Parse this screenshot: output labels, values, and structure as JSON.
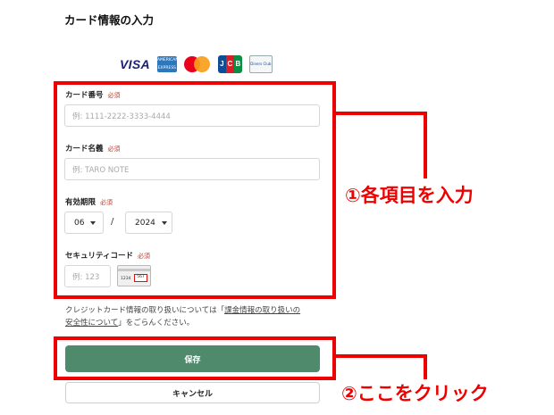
{
  "page": {
    "title": "カード情報の入力"
  },
  "brands": {
    "visa": "VISA",
    "amex": "AMERICAN EXPRESS",
    "jcb": [
      "J",
      "C",
      "B"
    ],
    "diners": "Diners Club"
  },
  "form": {
    "card_number": {
      "label": "カード番号",
      "required": "必須",
      "placeholder": "例: 1111-2222-3333-4444"
    },
    "card_name": {
      "label": "カード名義",
      "required": "必須",
      "placeholder": "例: TARO NOTE"
    },
    "expiry": {
      "label": "有効期限",
      "required": "必須",
      "month": "06",
      "separator": "/",
      "year": "2024"
    },
    "security": {
      "label": "セキュリティコード",
      "required": "必須",
      "placeholder": "例: 123",
      "sample_number": "1234",
      "sample_cvv": "567"
    }
  },
  "notice": {
    "line1_prefix": "クレジットカード情報の取り扱いについては「",
    "link_part1": "課金情報の取り扱いの",
    "link_part2": "安全性について",
    "line2_suffix": "」をごらんください。"
  },
  "buttons": {
    "save": "保存",
    "cancel": "キャンセル"
  },
  "annotations": {
    "step1": "①各項目を入力",
    "step2": "②ここをクリック"
  },
  "colors": {
    "accent_red": "#ee0000",
    "save_green": "#4f8a6d",
    "required_red": "#c0392b"
  }
}
